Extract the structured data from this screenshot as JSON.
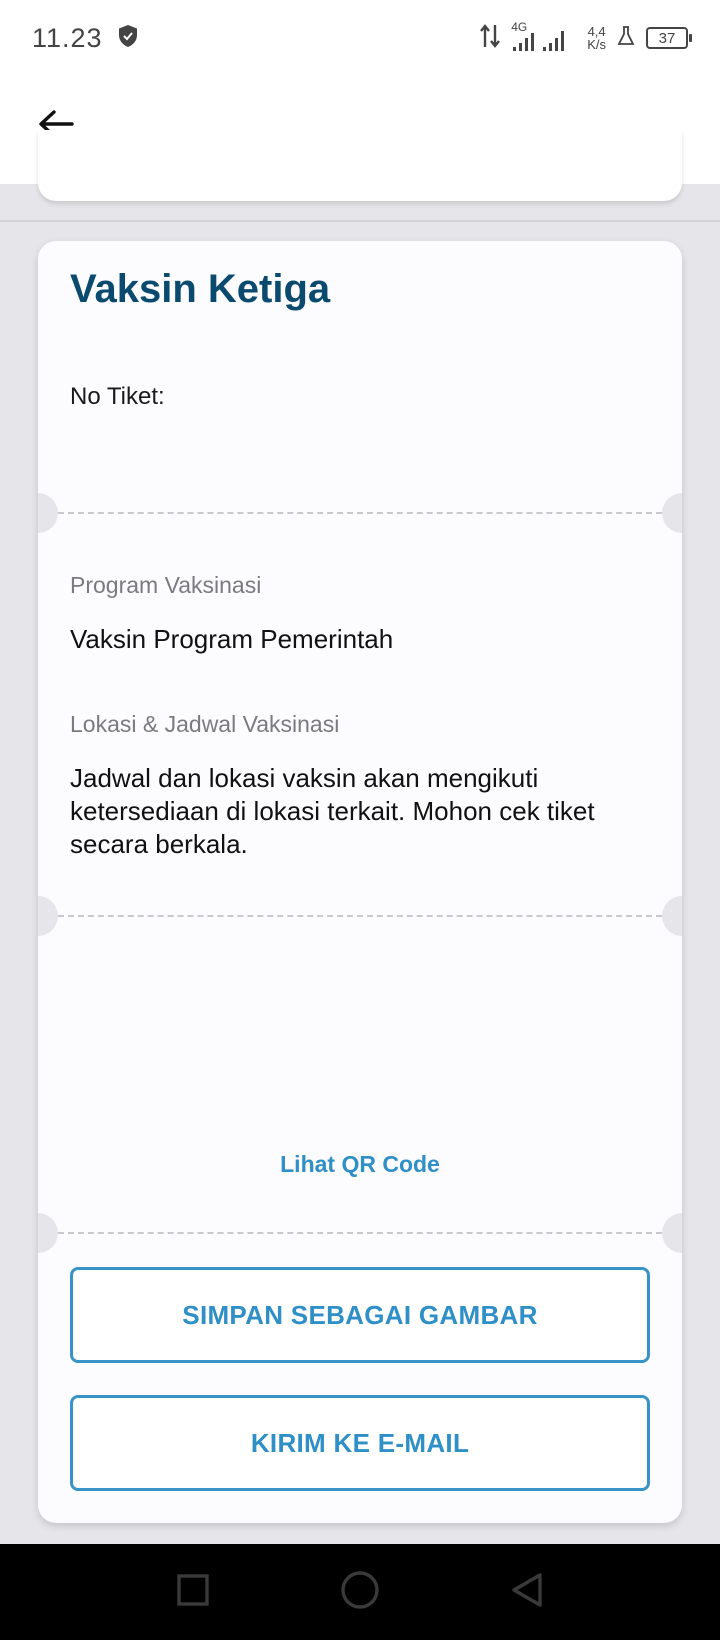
{
  "status_bar": {
    "time": "11.23",
    "network_type": "4G",
    "speed_value": "4,4",
    "speed_unit": "K/s",
    "battery": "37"
  },
  "card": {
    "title": "Vaksin Ketiga",
    "ticket_label": "No Tiket:",
    "program_label": "Program Vaksinasi",
    "program_value": "Vaksin Program Pemerintah",
    "location_label": "Lokasi & Jadwal Vaksinasi",
    "location_value": "Jadwal dan lokasi vaksin akan mengikuti ketersediaan di lokasi terkait. Mohon cek tiket secara berkala.",
    "qr_link": "Lihat QR Code",
    "save_button": "SIMPAN SEBAGAI GAMBAR",
    "email_button": "KIRIM KE E-MAIL"
  },
  "colors": {
    "title": "#0b4a6f",
    "accent": "#2f8fc7",
    "background": "#e6e6ea"
  },
  "icons": [
    "shield-icon",
    "data-arrows-icon",
    "signal-icon",
    "flask-icon",
    "battery-icon",
    "back-arrow-icon",
    "square-icon",
    "circle-icon",
    "triangle-back-icon"
  ]
}
